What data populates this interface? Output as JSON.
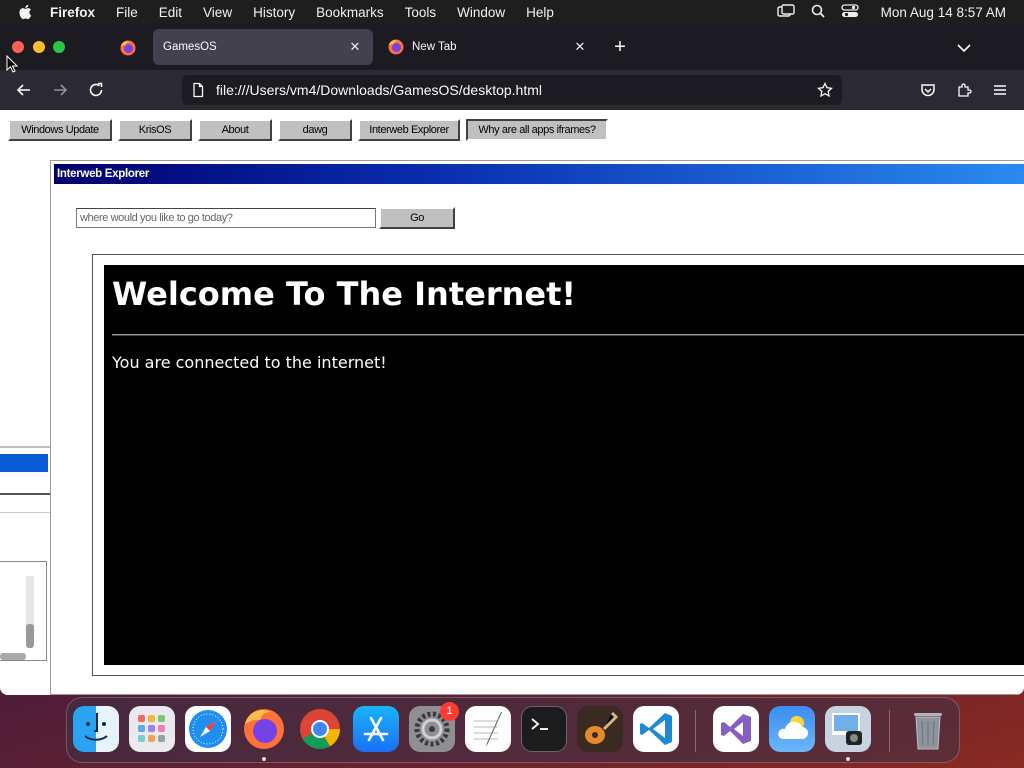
{
  "menubar": {
    "app_name": "Firefox",
    "items": [
      "File",
      "Edit",
      "View",
      "History",
      "Bookmarks",
      "Tools",
      "Window",
      "Help"
    ],
    "clock": "Mon Aug 14  8:57 AM",
    "status_icons": [
      "screen-mirroring-icon",
      "spotlight-search-icon",
      "control-center-icon"
    ]
  },
  "browser": {
    "tabs": [
      {
        "label": "GamesOS",
        "active": true
      },
      {
        "label": "New Tab",
        "active": false
      }
    ],
    "url": "file:///Users/vm4/Downloads/GamesOS/desktop.html"
  },
  "gamesos": {
    "apps": [
      "Windows Update",
      "KrisOS",
      "About",
      "dawg",
      "Interweb Explorer",
      "Why are all apps iframes?"
    ],
    "explorer": {
      "title": "Interweb Explorer",
      "url_placeholder": "where would you like to go today?",
      "go_label": "Go",
      "page": {
        "heading": "Welcome To The Internet!",
        "message": "You are connected to the internet!"
      }
    }
  },
  "dock": {
    "apps": [
      "Finder",
      "Launchpad",
      "Safari",
      "Firefox",
      "Google Chrome",
      "App Store",
      "System Settings",
      "TextEdit",
      "Terminal",
      "GarageBand",
      "Visual Studio Code",
      "Visual Studio",
      "Weather",
      "Preview",
      "Trash"
    ],
    "system_settings_badge": "1"
  },
  "colors": {
    "menubar_bg": "#1e1e1e",
    "tabstrip_bg": "#1c1b22",
    "toolbar_bg": "#2b2a33",
    "titlebar_start": "#00006e",
    "titlebar_end": "#2a8cf0",
    "win95_button": "#c0c0c0"
  }
}
